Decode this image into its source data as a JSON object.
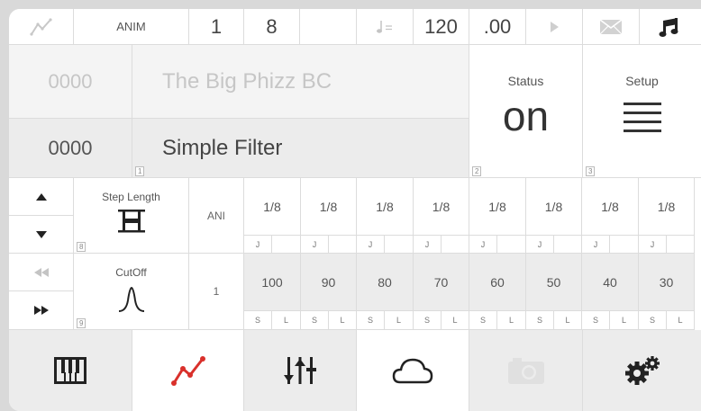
{
  "top_bar": {
    "mode": "ANIM",
    "value1": "1",
    "value2": "8",
    "value3": "",
    "tempo_integer": "120",
    "tempo_decimal": ".00"
  },
  "preset": {
    "id1": "0000",
    "name1": "The Big Phizz BC",
    "id2": "0000",
    "name2": "Simple Filter",
    "badge": "1"
  },
  "status": {
    "label": "Status",
    "value": "on",
    "badge": "2"
  },
  "setup": {
    "label": "Setup",
    "badge": "3"
  },
  "step_length": {
    "label": "Step Length",
    "badge": "8",
    "mode": "ANI",
    "steps": [
      "1/8",
      "1/8",
      "1/8",
      "1/8",
      "1/8",
      "1/8",
      "1/8",
      "1/8"
    ],
    "sub": [
      "J",
      "J",
      "J",
      "J",
      "J",
      "J",
      "J",
      "J"
    ]
  },
  "cutoff": {
    "label": "CutOff",
    "badge": "9",
    "mode": "1",
    "steps": [
      "100",
      "90",
      "80",
      "70",
      "60",
      "50",
      "40",
      "30"
    ],
    "s_label": "S",
    "l_label": "L"
  },
  "colors": {
    "accent": "#d9302b",
    "grid": "#dcdcdc",
    "gray": "#ececec"
  },
  "nav_icons": [
    "piano-icon",
    "automation-icon",
    "mixer-icon",
    "cloud-icon",
    "camera-icon",
    "gears-icon"
  ]
}
